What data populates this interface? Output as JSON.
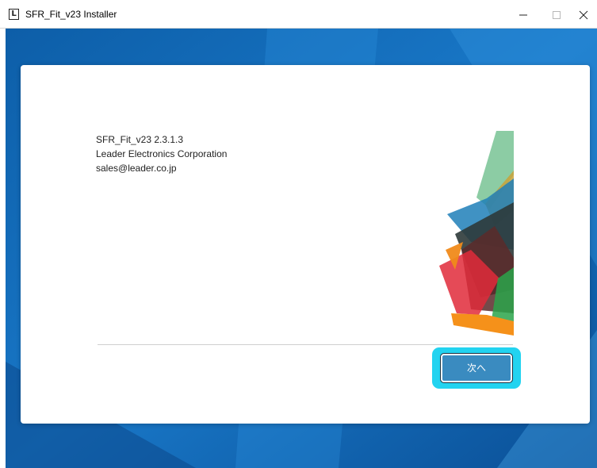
{
  "window": {
    "title": "SFR_Fit_v23 Installer",
    "icon_letter": "L"
  },
  "info": {
    "product_line": "SFR_Fit_v23 2.3.1.3",
    "company": "Leader Electronics Corporation",
    "email": "sales@leader.co.jp"
  },
  "buttons": {
    "next_label": "次へ"
  },
  "colors": {
    "background_blue": "#1a7fd1",
    "button_blue": "#3a8bc0",
    "focus_highlight": "#22d3f0"
  }
}
